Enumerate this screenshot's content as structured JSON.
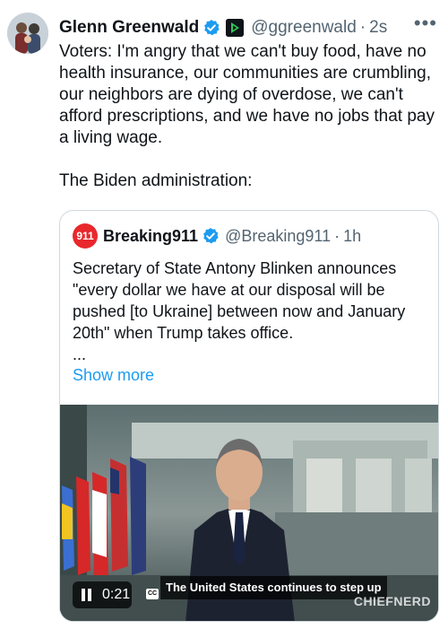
{
  "author": {
    "name": "Glenn Greenwald",
    "handle": "@ggreenwald",
    "separator": "·",
    "time": "2s",
    "more_icon": "more-horizontal-icon"
  },
  "tweet": {
    "paragraph1": "Voters: I'm angry that we can't buy food, have no health insurance, our communities are crumbling, our neighbors are dying of overdose, we can't afford prescriptions, and we have no jobs that pay a living wage.",
    "paragraph2": "The Biden administration:"
  },
  "quote": {
    "name": "Breaking911",
    "handle": "@Breaking911",
    "separator": "·",
    "time": "1h",
    "avatar_text": "911",
    "text": "Secretary of State Antony Blinken announces \"every dollar we have at our disposal will be pushed [to Ukraine] between now and January 20th\" when Trump takes office.",
    "ellipsis": "...",
    "show_more": "Show more"
  },
  "video": {
    "timestamp": "0:21",
    "cc_label": "CC",
    "caption": "The United States continues to step up",
    "watermark": "CHIEFNERD"
  },
  "colors": {
    "link": "#1d9bf0",
    "verified": "#1d9bf0",
    "secondary_text": "#536471"
  }
}
